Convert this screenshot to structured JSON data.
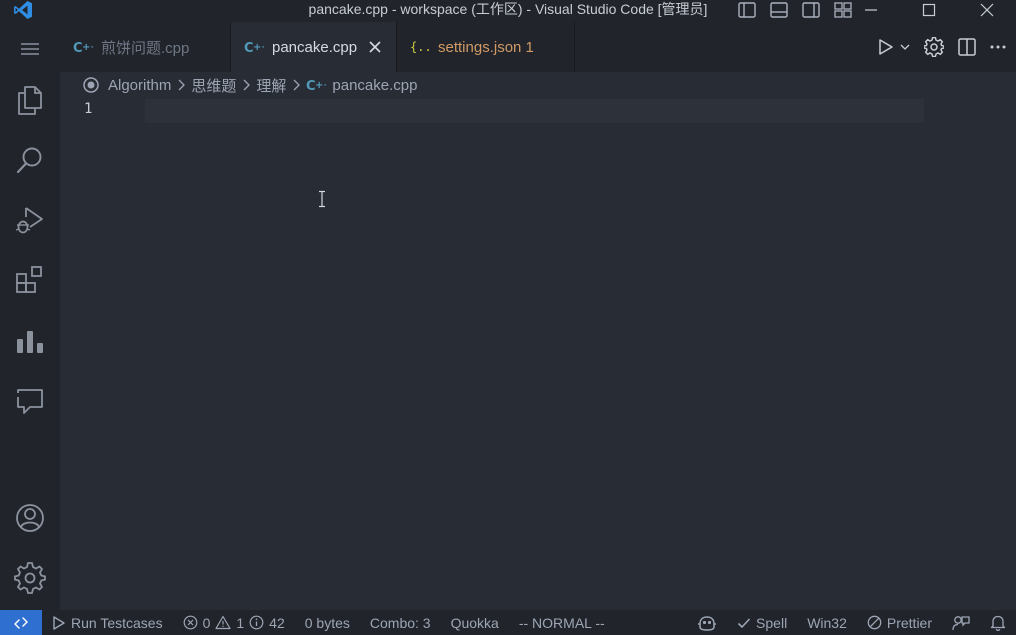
{
  "titlebar": {
    "title": "pancake.cpp - workspace (工作区) - Visual Studio Code [管理员]",
    "layout_icons": [
      "toggle-primary-sidebar-icon",
      "toggle-panel-icon",
      "toggle-secondary-sidebar-icon",
      "customize-layout-icon"
    ],
    "window_controls": [
      "minimize-icon",
      "maximize-icon",
      "close-icon"
    ]
  },
  "activity_bar": {
    "top_icons": [
      "menu-icon",
      "explorer-icon",
      "search-icon",
      "run-debug-icon",
      "extensions-icon",
      "chart-icon",
      "comments-icon"
    ],
    "bottom_icons": [
      "account-icon",
      "settings-gear-icon"
    ]
  },
  "tabs": [
    {
      "label": "煎饼问题.cpp",
      "icon": "cpp-icon",
      "state": "inactive"
    },
    {
      "label": "pancake.cpp",
      "icon": "cpp-icon",
      "state": "active"
    },
    {
      "label": "settings.json 1",
      "icon": "json-icon",
      "state": "warning"
    }
  ],
  "breadcrumb": {
    "items": [
      "Algorithm",
      "思维题",
      "理解",
      "pancake.cpp"
    ]
  },
  "editor": {
    "line_numbers": [
      "1"
    ]
  },
  "statusbar": {
    "run_testcases": "Run Testcases",
    "errors": "0",
    "warnings": "1",
    "info": "42",
    "size": "0 bytes",
    "combo": "Combo: 3",
    "quokka": "Quokka",
    "mode": "-- NORMAL --",
    "spell": "Spell",
    "eol": "Win32",
    "prettier": "Prettier"
  },
  "colors": {
    "background": "#282c34",
    "chrome": "#21252b",
    "accent_blue": "#2f6fcf",
    "cpp_blue": "#519aba",
    "json_yellow": "#cbcb41",
    "warning_orange": "#d19a66"
  }
}
